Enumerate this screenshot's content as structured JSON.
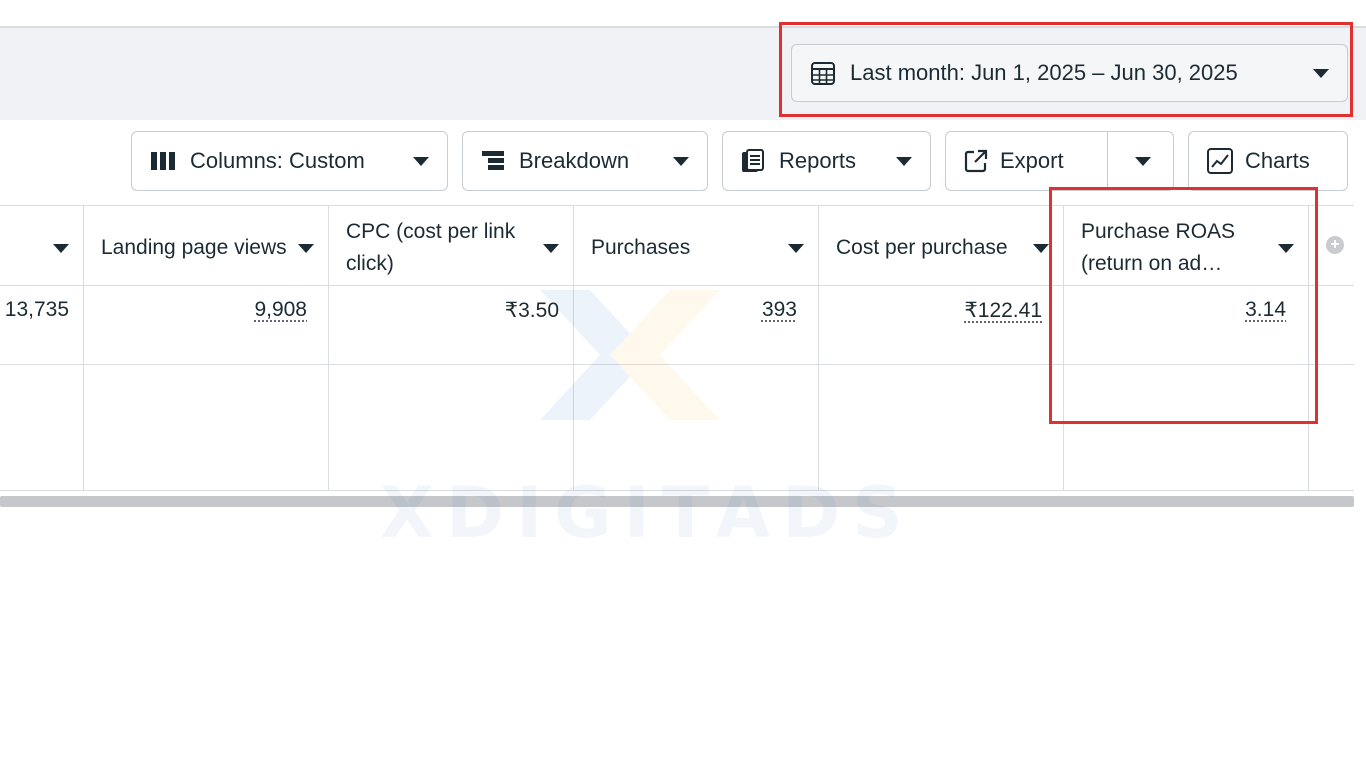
{
  "date_range": {
    "label": "Last month: Jun 1, 2025 – Jun 30, 2025",
    "icon": "calendar-icon"
  },
  "toolbar": {
    "columns_label": "Columns: Custom",
    "breakdown_label": "Breakdown",
    "reports_label": "Reports",
    "export_label": "Export",
    "charts_label": "Charts"
  },
  "table": {
    "columns": [
      {
        "header": "",
        "value": "13,735",
        "dotted": false
      },
      {
        "header": "Landing page views",
        "value": "9,908",
        "dotted": true
      },
      {
        "header": "CPC (cost per link click)",
        "value": "₹3.50",
        "dotted": false
      },
      {
        "header": "Purchases",
        "value": "393",
        "dotted": true
      },
      {
        "header": "Cost per purchase",
        "value": "₹122.41",
        "dotted": true
      },
      {
        "header": "Purchase ROAS (return on ad…",
        "value": "3.14",
        "dotted": true
      }
    ]
  },
  "watermark": {
    "text": "XDIGITADS"
  },
  "colors": {
    "highlight": "#e03131",
    "header_bg": "#f0f2f5",
    "text": "#1c2b33"
  }
}
